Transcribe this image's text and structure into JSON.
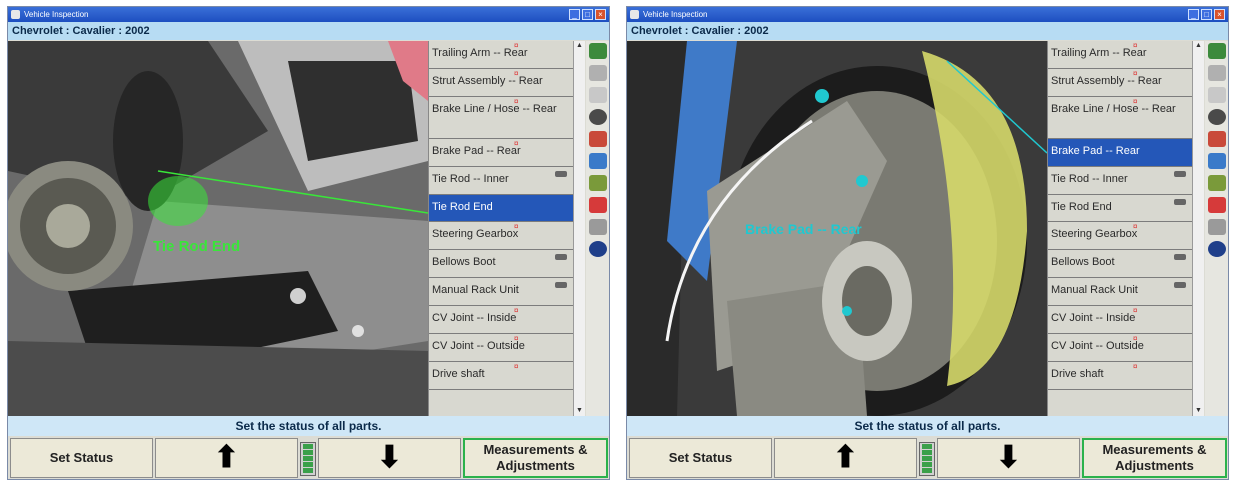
{
  "screens": [
    {
      "window_title": "Vehicle Inspection",
      "vehicle": "Chevrolet : Cavalier : 2002",
      "photo_label": "Tie Rod End",
      "parts": [
        {
          "label": "Trailing Arm -- Rear"
        },
        {
          "label": "Strut Assembly -- Rear"
        },
        {
          "label": "Brake Line / Hose -- Rear"
        },
        {
          "label": "Brake Pad -- Rear"
        },
        {
          "label": "Tie Rod -- Inner"
        },
        {
          "label": "Tie Rod End"
        },
        {
          "label": "Steering Gearbox"
        },
        {
          "label": "Bellows Boot"
        },
        {
          "label": "Manual Rack Unit"
        },
        {
          "label": "CV Joint -- Inside"
        },
        {
          "label": "CV Joint -- Outside"
        },
        {
          "label": "Drive shaft"
        }
      ],
      "selected_part": "Tie Rod End",
      "status_text": "Set the status of all parts.",
      "buttons": {
        "set_status": "Set Status",
        "measurements": "Measurements & Adjustments"
      }
    },
    {
      "window_title": "Vehicle Inspection",
      "vehicle": "Chevrolet : Cavalier : 2002",
      "photo_label": "Brake Pad -- Rear",
      "parts": [
        {
          "label": "Trailing Arm -- Rear"
        },
        {
          "label": "Strut Assembly -- Rear"
        },
        {
          "label": "Brake Line / Hose -- Rear"
        },
        {
          "label": "Brake Pad -- Rear"
        },
        {
          "label": "Tie Rod -- Inner"
        },
        {
          "label": "Tie Rod End"
        },
        {
          "label": "Steering Gearbox"
        },
        {
          "label": "Bellows Boot"
        },
        {
          "label": "Manual Rack Unit"
        },
        {
          "label": "CV Joint -- Inside"
        },
        {
          "label": "CV Joint -- Outside"
        },
        {
          "label": "Drive shaft"
        }
      ],
      "selected_part": "Brake Pad -- Rear",
      "status_text": "Set the status of all parts.",
      "buttons": {
        "set_status": "Set Status",
        "measurements": "Measurements & Adjustments"
      }
    }
  ],
  "icons": [
    "help-icon",
    "vehicle-icon",
    "clipboard-icon",
    "wrench-icon",
    "car-lift-icon",
    "person-icon",
    "printer-icon",
    "lightning-icon",
    "tools-icon",
    "globe-icon"
  ],
  "colors": {
    "title_bar": "#1d4fc0",
    "vehicle_bar": "#b7dcf3",
    "selected_row": "#2457b8",
    "highlight_left": "#39e639",
    "highlight_right": "#20c8d0",
    "measure_border": "#2bb24c"
  }
}
